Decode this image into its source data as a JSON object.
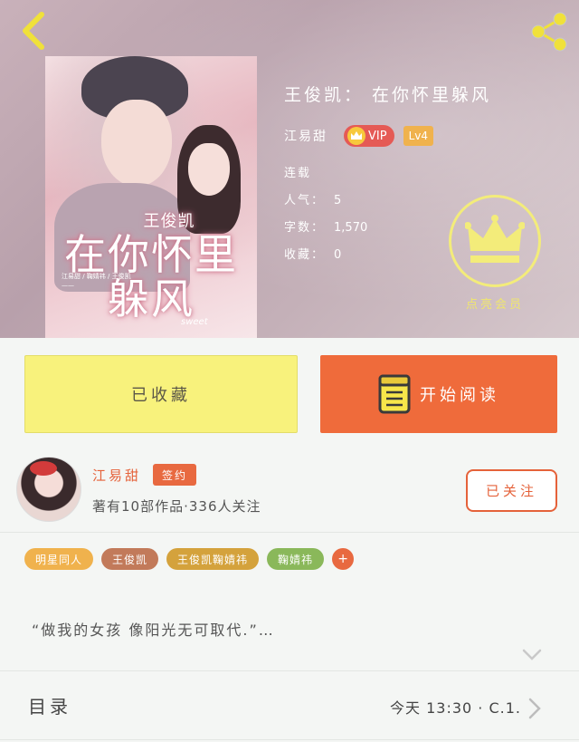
{
  "book": {
    "title": "王俊凯： 在你怀里躲风",
    "author": "江易甜",
    "vip_label": "VIP",
    "level": "Lv4",
    "status": "连载",
    "stats": [
      {
        "label": "人气：",
        "value": "5"
      },
      {
        "label": "字数：",
        "value": "1,570"
      },
      {
        "label": "收藏：",
        "value": "0"
      }
    ],
    "vip_member_label": "点亮会员"
  },
  "cover": {
    "author_text": "王俊凯",
    "title_line1": "在你怀里",
    "title_line2": "躲风",
    "blurb": "江易甜 / 鞠婧祎 / 王俊凯 ——",
    "sweet": "sweet"
  },
  "actions": {
    "collect_label": "已收藏",
    "read_label": "开始阅读"
  },
  "author": {
    "name": "江易甜",
    "sign_badge": "签约",
    "works_info": "著有10部作品·336人关注",
    "follow_label": "已关注"
  },
  "tags": [
    {
      "label": "明星同人",
      "color": "#f0b24d"
    },
    {
      "label": "王俊凯",
      "color": "#c27a5a"
    },
    {
      "label": "王俊凯鞠婧祎",
      "color": "#d4a23c"
    },
    {
      "label": "鞠婧祎",
      "color": "#8ab85a"
    }
  ],
  "tag_add_label": "+",
  "description": "“做我的女孩 像阳光无可取代.”…",
  "toc": {
    "label": "目录",
    "update": "今天 13:30 · C.1."
  },
  "colors": {
    "accent": "#e5623a",
    "collect_bg": "#f8f27c",
    "read_bg": "#ef6b3b",
    "vip_gold": "#f3ec7a"
  },
  "icons": {
    "back": "chevron-left-icon",
    "share": "share-icon",
    "crown": "crown-icon",
    "book": "book-icon",
    "expand": "chevron-down-icon",
    "toc_arrow": "chevron-right-icon"
  }
}
